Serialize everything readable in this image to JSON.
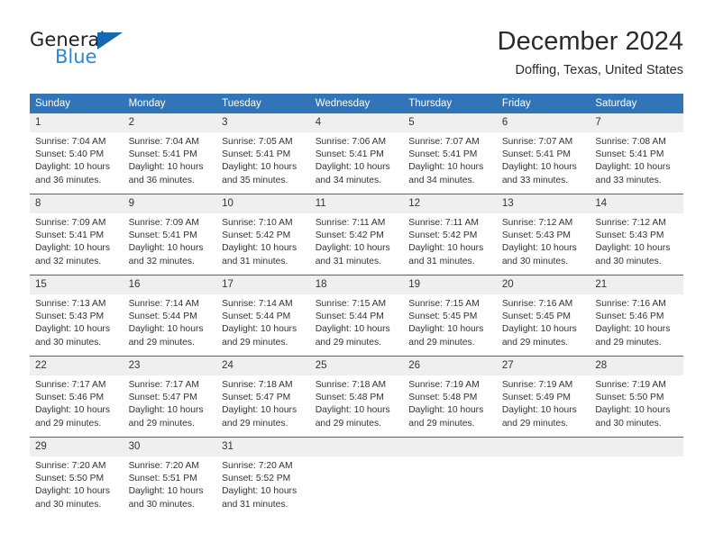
{
  "logo": {
    "word1": "General",
    "word2": "Blue",
    "triangle_color": "#1567b3",
    "word2_color": "#2b87d3"
  },
  "header": {
    "title": "December 2024",
    "subtitle": "Doffing, Texas, United States"
  },
  "theme": {
    "header_blue": "#3174b8",
    "row_divider": "#2e6da4",
    "daynum_band": "#efefef",
    "text": "#333333"
  },
  "weekday_headers": [
    "Sunday",
    "Monday",
    "Tuesday",
    "Wednesday",
    "Thursday",
    "Friday",
    "Saturday"
  ],
  "weeks": [
    [
      {
        "day": "1",
        "sunrise": "Sunrise: 7:04 AM",
        "sunset": "Sunset: 5:40 PM",
        "daylight1": "Daylight: 10 hours",
        "daylight2": "and 36 minutes."
      },
      {
        "day": "2",
        "sunrise": "Sunrise: 7:04 AM",
        "sunset": "Sunset: 5:41 PM",
        "daylight1": "Daylight: 10 hours",
        "daylight2": "and 36 minutes."
      },
      {
        "day": "3",
        "sunrise": "Sunrise: 7:05 AM",
        "sunset": "Sunset: 5:41 PM",
        "daylight1": "Daylight: 10 hours",
        "daylight2": "and 35 minutes."
      },
      {
        "day": "4",
        "sunrise": "Sunrise: 7:06 AM",
        "sunset": "Sunset: 5:41 PM",
        "daylight1": "Daylight: 10 hours",
        "daylight2": "and 34 minutes."
      },
      {
        "day": "5",
        "sunrise": "Sunrise: 7:07 AM",
        "sunset": "Sunset: 5:41 PM",
        "daylight1": "Daylight: 10 hours",
        "daylight2": "and 34 minutes."
      },
      {
        "day": "6",
        "sunrise": "Sunrise: 7:07 AM",
        "sunset": "Sunset: 5:41 PM",
        "daylight1": "Daylight: 10 hours",
        "daylight2": "and 33 minutes."
      },
      {
        "day": "7",
        "sunrise": "Sunrise: 7:08 AM",
        "sunset": "Sunset: 5:41 PM",
        "daylight1": "Daylight: 10 hours",
        "daylight2": "and 33 minutes."
      }
    ],
    [
      {
        "day": "8",
        "sunrise": "Sunrise: 7:09 AM",
        "sunset": "Sunset: 5:41 PM",
        "daylight1": "Daylight: 10 hours",
        "daylight2": "and 32 minutes."
      },
      {
        "day": "9",
        "sunrise": "Sunrise: 7:09 AM",
        "sunset": "Sunset: 5:41 PM",
        "daylight1": "Daylight: 10 hours",
        "daylight2": "and 32 minutes."
      },
      {
        "day": "10",
        "sunrise": "Sunrise: 7:10 AM",
        "sunset": "Sunset: 5:42 PM",
        "daylight1": "Daylight: 10 hours",
        "daylight2": "and 31 minutes."
      },
      {
        "day": "11",
        "sunrise": "Sunrise: 7:11 AM",
        "sunset": "Sunset: 5:42 PM",
        "daylight1": "Daylight: 10 hours",
        "daylight2": "and 31 minutes."
      },
      {
        "day": "12",
        "sunrise": "Sunrise: 7:11 AM",
        "sunset": "Sunset: 5:42 PM",
        "daylight1": "Daylight: 10 hours",
        "daylight2": "and 31 minutes."
      },
      {
        "day": "13",
        "sunrise": "Sunrise: 7:12 AM",
        "sunset": "Sunset: 5:43 PM",
        "daylight1": "Daylight: 10 hours",
        "daylight2": "and 30 minutes."
      },
      {
        "day": "14",
        "sunrise": "Sunrise: 7:12 AM",
        "sunset": "Sunset: 5:43 PM",
        "daylight1": "Daylight: 10 hours",
        "daylight2": "and 30 minutes."
      }
    ],
    [
      {
        "day": "15",
        "sunrise": "Sunrise: 7:13 AM",
        "sunset": "Sunset: 5:43 PM",
        "daylight1": "Daylight: 10 hours",
        "daylight2": "and 30 minutes."
      },
      {
        "day": "16",
        "sunrise": "Sunrise: 7:14 AM",
        "sunset": "Sunset: 5:44 PM",
        "daylight1": "Daylight: 10 hours",
        "daylight2": "and 29 minutes."
      },
      {
        "day": "17",
        "sunrise": "Sunrise: 7:14 AM",
        "sunset": "Sunset: 5:44 PM",
        "daylight1": "Daylight: 10 hours",
        "daylight2": "and 29 minutes."
      },
      {
        "day": "18",
        "sunrise": "Sunrise: 7:15 AM",
        "sunset": "Sunset: 5:44 PM",
        "daylight1": "Daylight: 10 hours",
        "daylight2": "and 29 minutes."
      },
      {
        "day": "19",
        "sunrise": "Sunrise: 7:15 AM",
        "sunset": "Sunset: 5:45 PM",
        "daylight1": "Daylight: 10 hours",
        "daylight2": "and 29 minutes."
      },
      {
        "day": "20",
        "sunrise": "Sunrise: 7:16 AM",
        "sunset": "Sunset: 5:45 PM",
        "daylight1": "Daylight: 10 hours",
        "daylight2": "and 29 minutes."
      },
      {
        "day": "21",
        "sunrise": "Sunrise: 7:16 AM",
        "sunset": "Sunset: 5:46 PM",
        "daylight1": "Daylight: 10 hours",
        "daylight2": "and 29 minutes."
      }
    ],
    [
      {
        "day": "22",
        "sunrise": "Sunrise: 7:17 AM",
        "sunset": "Sunset: 5:46 PM",
        "daylight1": "Daylight: 10 hours",
        "daylight2": "and 29 minutes."
      },
      {
        "day": "23",
        "sunrise": "Sunrise: 7:17 AM",
        "sunset": "Sunset: 5:47 PM",
        "daylight1": "Daylight: 10 hours",
        "daylight2": "and 29 minutes."
      },
      {
        "day": "24",
        "sunrise": "Sunrise: 7:18 AM",
        "sunset": "Sunset: 5:47 PM",
        "daylight1": "Daylight: 10 hours",
        "daylight2": "and 29 minutes."
      },
      {
        "day": "25",
        "sunrise": "Sunrise: 7:18 AM",
        "sunset": "Sunset: 5:48 PM",
        "daylight1": "Daylight: 10 hours",
        "daylight2": "and 29 minutes."
      },
      {
        "day": "26",
        "sunrise": "Sunrise: 7:19 AM",
        "sunset": "Sunset: 5:48 PM",
        "daylight1": "Daylight: 10 hours",
        "daylight2": "and 29 minutes."
      },
      {
        "day": "27",
        "sunrise": "Sunrise: 7:19 AM",
        "sunset": "Sunset: 5:49 PM",
        "daylight1": "Daylight: 10 hours",
        "daylight2": "and 29 minutes."
      },
      {
        "day": "28",
        "sunrise": "Sunrise: 7:19 AM",
        "sunset": "Sunset: 5:50 PM",
        "daylight1": "Daylight: 10 hours",
        "daylight2": "and 30 minutes."
      }
    ],
    [
      {
        "day": "29",
        "sunrise": "Sunrise: 7:20 AM",
        "sunset": "Sunset: 5:50 PM",
        "daylight1": "Daylight: 10 hours",
        "daylight2": "and 30 minutes."
      },
      {
        "day": "30",
        "sunrise": "Sunrise: 7:20 AM",
        "sunset": "Sunset: 5:51 PM",
        "daylight1": "Daylight: 10 hours",
        "daylight2": "and 30 minutes."
      },
      {
        "day": "31",
        "sunrise": "Sunrise: 7:20 AM",
        "sunset": "Sunset: 5:52 PM",
        "daylight1": "Daylight: 10 hours",
        "daylight2": "and 31 minutes."
      },
      {
        "day": "",
        "sunrise": "",
        "sunset": "",
        "daylight1": "",
        "daylight2": ""
      },
      {
        "day": "",
        "sunrise": "",
        "sunset": "",
        "daylight1": "",
        "daylight2": ""
      },
      {
        "day": "",
        "sunrise": "",
        "sunset": "",
        "daylight1": "",
        "daylight2": ""
      },
      {
        "day": "",
        "sunrise": "",
        "sunset": "",
        "daylight1": "",
        "daylight2": ""
      }
    ]
  ]
}
